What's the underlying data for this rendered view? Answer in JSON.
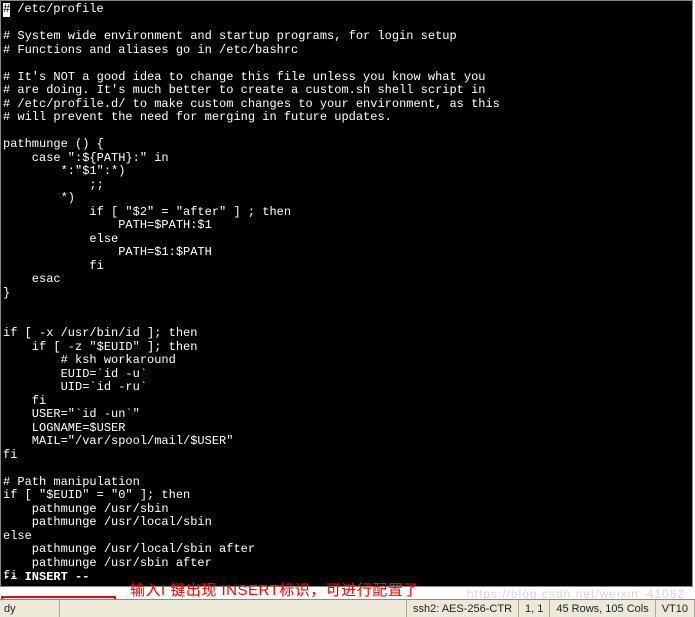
{
  "editor": {
    "lines": [
      "# /etc/profile",
      "",
      "# System wide environment and startup programs, for login setup",
      "# Functions and aliases go in /etc/bashrc",
      "",
      "# It's NOT a good idea to change this file unless you know what you",
      "# are doing. It's much better to create a custom.sh shell script in",
      "# /etc/profile.d/ to make custom changes to your environment, as this",
      "# will prevent the need for merging in future updates.",
      "",
      "pathmunge () {",
      "    case \":${PATH}:\" in",
      "        *:\"$1\":*)",
      "            ;;",
      "        *)",
      "            if [ \"$2\" = \"after\" ] ; then",
      "                PATH=$PATH:$1",
      "            else",
      "                PATH=$1:$PATH",
      "            fi",
      "    esac",
      "}",
      "",
      "",
      "if [ -x /usr/bin/id ]; then",
      "    if [ -z \"$EUID\" ]; then",
      "        # ksh workaround",
      "        EUID=`id -u`",
      "        UID=`id -ru`",
      "    fi",
      "    USER=\"`id -un`\"",
      "    LOGNAME=$USER",
      "    MAIL=\"/var/spool/mail/$USER\"",
      "fi",
      "",
      "# Path manipulation",
      "if [ \"$EUID\" = \"0\" ]; then",
      "    pathmunge /usr/sbin",
      "    pathmunge /usr/local/sbin",
      "else",
      "    pathmunge /usr/local/sbin after",
      "    pathmunge /usr/sbin after",
      "fi"
    ],
    "mode_line": "-- INSERT --"
  },
  "annotation": {
    "text": "输入I 键出现 INSERT标识，可进行配置了"
  },
  "statusbar": {
    "ready": "dy",
    "cipher": "ssh2: AES-256-CTR",
    "cursor": "  1,    1",
    "dims": "45 Rows, 105 Cols",
    "emu": "VT10"
  },
  "watermark": "https://blog.csdn.net/weixin_41082"
}
